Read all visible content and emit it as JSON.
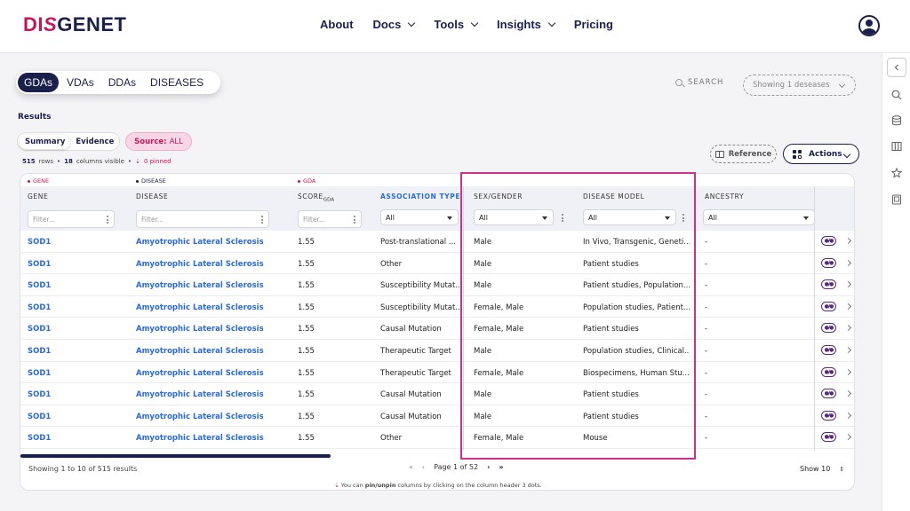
{
  "header": {
    "logo_dis": "DI",
    "logo_slash": "S",
    "logo_genet": "GENET",
    "nav": [
      {
        "label": "About",
        "has_menu": false
      },
      {
        "label": "Docs",
        "has_menu": true
      },
      {
        "label": "Tools",
        "has_menu": true
      },
      {
        "label": "Insights",
        "has_menu": true
      },
      {
        "label": "Pricing",
        "has_menu": false
      }
    ],
    "user_icon": "user-circle-icon"
  },
  "type_tabs": [
    {
      "label": "GDAs",
      "active": true
    },
    {
      "label": "VDAs",
      "active": false
    },
    {
      "label": "DDAs",
      "active": false
    },
    {
      "label": "DISEASES",
      "active": false
    }
  ],
  "search": {
    "label": "SEARCH",
    "showing": "Showing 1 deseases"
  },
  "results_label": "Results",
  "view_toggle": {
    "summary": "Summary",
    "evidence": "Evidence",
    "active": "Summary"
  },
  "source": {
    "label": "Source:",
    "value": "ALL"
  },
  "counts": {
    "rows": "515",
    "rows_label": "rows",
    "cols": "18",
    "cols_label": "columns visible",
    "pinned": "0 pinned"
  },
  "buttons": {
    "reference": "Reference",
    "actions": "Actions"
  },
  "table": {
    "groups": [
      {
        "label": "GENE",
        "color": "#c2185b"
      },
      {
        "label": "DISEASE",
        "color": "#1b1f4b"
      },
      {
        "label": "GDA",
        "color": "#c2185b"
      }
    ],
    "columns": {
      "gene": "GENE",
      "disease": "DISEASE",
      "score": "SCORE",
      "score_sub": "GDA",
      "assoc": "ASSOCIATION TYPE",
      "sex": "SEX/GENDER",
      "model": "DISEASE MODEL",
      "ancestry": "ANCESTRY"
    },
    "filter_placeholder": "Filter...",
    "select_all": "All",
    "rows": [
      {
        "gene": "SOD1",
        "disease": "Amyotrophic Lateral Sclerosis",
        "score": "1.55",
        "assoc": "Post-translational ...",
        "sex": "Male",
        "model": "In Vivo, Transgenic, Geneti...",
        "ancestry": "-"
      },
      {
        "gene": "SOD1",
        "disease": "Amyotrophic Lateral Sclerosis",
        "score": "1.55",
        "assoc": "Other",
        "sex": "Male",
        "model": "Patient studies",
        "ancestry": "-"
      },
      {
        "gene": "SOD1",
        "disease": "Amyotrophic Lateral Sclerosis",
        "score": "1.55",
        "assoc": "Susceptibility Mutat...",
        "sex": "Male",
        "model": "Patient studies, Population...",
        "ancestry": "-"
      },
      {
        "gene": "SOD1",
        "disease": "Amyotrophic Lateral Sclerosis",
        "score": "1.55",
        "assoc": "Susceptibility Mutat...",
        "sex": "Female, Male",
        "model": "Population studies, Patient...",
        "ancestry": "-"
      },
      {
        "gene": "SOD1",
        "disease": "Amyotrophic Lateral Sclerosis",
        "score": "1.55",
        "assoc": "Causal Mutation",
        "sex": "Female, Male",
        "model": "Patient studies",
        "ancestry": "-"
      },
      {
        "gene": "SOD1",
        "disease": "Amyotrophic Lateral Sclerosis",
        "score": "1.55",
        "assoc": "Therapeutic Target",
        "sex": "Male",
        "model": "Population studies, Clinical...",
        "ancestry": "-"
      },
      {
        "gene": "SOD1",
        "disease": "Amyotrophic Lateral Sclerosis",
        "score": "1.55",
        "assoc": "Therapeutic Target",
        "sex": "Female, Male",
        "model": "Biospecimens, Human Stu...",
        "ancestry": "-"
      },
      {
        "gene": "SOD1",
        "disease": "Amyotrophic Lateral Sclerosis",
        "score": "1.55",
        "assoc": "Causal Mutation",
        "sex": "Male",
        "model": "Patient studies",
        "ancestry": "-"
      },
      {
        "gene": "SOD1",
        "disease": "Amyotrophic Lateral Sclerosis",
        "score": "1.55",
        "assoc": "Causal Mutation",
        "sex": "Male",
        "model": "Patient studies",
        "ancestry": "-"
      },
      {
        "gene": "SOD1",
        "disease": "Amyotrophic Lateral Sclerosis",
        "score": "1.55",
        "assoc": "Other",
        "sex": "Female, Male",
        "model": "Mouse",
        "ancestry": "-"
      }
    ],
    "row_action_icon": "evidence-toggle-icon",
    "row_action_glyph": "●∕●"
  },
  "footer": {
    "showing": "Showing 1 to 10 of 515 results",
    "page_text": "Page 1 of 52",
    "show": "Show 10",
    "hint_prefix": "You can",
    "hint_bold": "pin/unpin",
    "hint_suffix": "columns by clicking on the column header 3 dots."
  },
  "rail_icons": [
    "chevron-left-icon",
    "search-icon",
    "database-icon",
    "columns-icon",
    "star-icon",
    "book-icon"
  ],
  "colors": {
    "brand_navy": "#1b1f4b",
    "brand_pink": "#c2185b",
    "link_blue": "#2a6bd6",
    "highlight": "#cc2f8c"
  }
}
